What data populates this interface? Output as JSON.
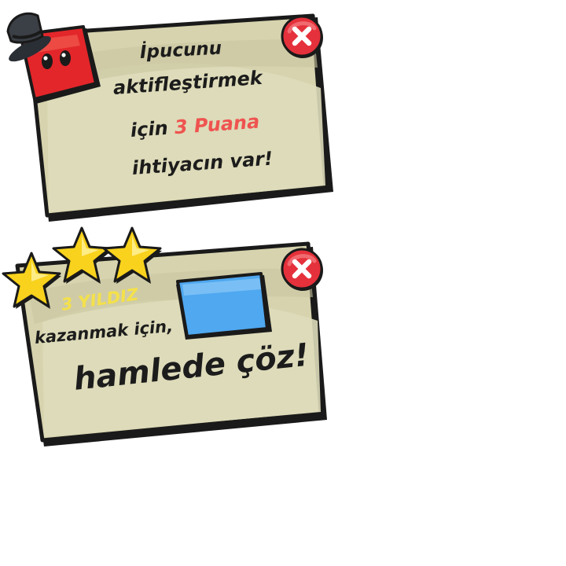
{
  "hint_dialog": {
    "line1": "İpucunu",
    "line2": "aktifleştirmek",
    "line3_prefix": "için",
    "line3_points": "3 Puana",
    "line4": "ihtiyacın var!",
    "accent_color": "#ef5350",
    "close_icon": "close-icon"
  },
  "star_dialog": {
    "stars_label": "3 YILDIZ",
    "star_count": 3,
    "line2": "kazanmak için,",
    "line3": "hamlede çöz!",
    "moves_box_color": "#4fa8f0",
    "close_icon": "close-icon"
  },
  "colors": {
    "card_fill": "#d6d3ae",
    "card_border": "#1a1a1a",
    "close_red": "#e5313b",
    "mascot_red": "#e3262a",
    "star_yellow": "#f8d21c",
    "label_yellow": "#f4e14a"
  }
}
